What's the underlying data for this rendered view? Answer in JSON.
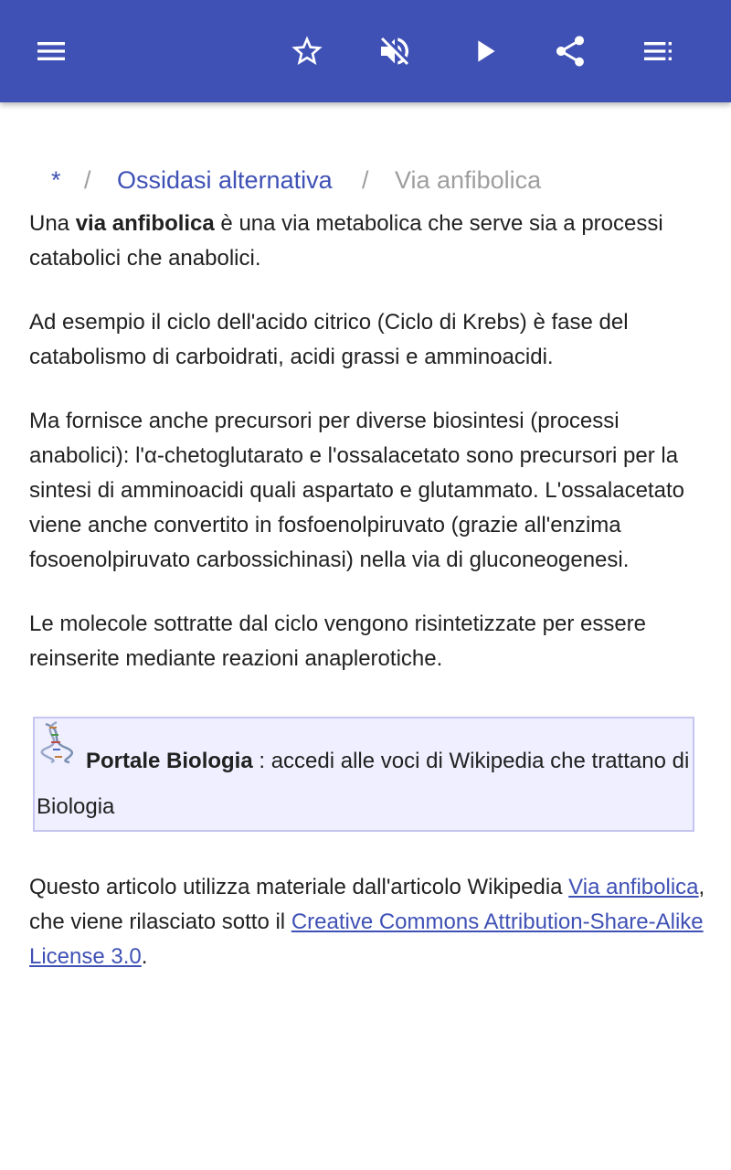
{
  "toolbar": {
    "icons": [
      "menu-icon",
      "star-icon",
      "volume-off-icon",
      "play-icon",
      "share-icon",
      "list-icon"
    ],
    "color": "#3f51b5"
  },
  "breadcrumb": {
    "home": "*",
    "separator": "/",
    "parent": "Ossidasi alternativa",
    "current": "Via anfibolica"
  },
  "article": {
    "p1_pre": "Una ",
    "p1_bold": "via anfibolica",
    "p1_post": " è una via metabolica che serve sia a processi catabolici che anabolici.",
    "p2": "Ad esempio il ciclo dell'acido citrico (Ciclo di Krebs) è fase del catabolismo di carboidrati, acidi grassi e amminoacidi.",
    "p3": "Ma fornisce anche precursori per diverse biosintesi (processi anabolici): l'α-chetoglutarato e l'ossalacetato sono precursori per la sintesi di amminoacidi quali aspartato e glutammato. L'ossalacetato viene anche convertito in fosfoenolpiruvato (grazie all'enzima fosoenolpiruvato carbossichinasi) nella via di gluconeogenesi.",
    "p4": "Le molecole sottratte dal ciclo vengono risintetizzate per essere reinserite mediante reazioni anaplerotiche."
  },
  "portal": {
    "icon": "dna-icon",
    "link": "Portale Biologia",
    "text": " : accedi alle voci di Wikipedia che trattano di Biologia"
  },
  "footer": {
    "pre": "Questo articolo utilizza materiale dall'articolo Wikipedia ",
    "link1": "Via anfibolica",
    "mid": ", che viene rilasciato sotto il ",
    "link2": "Creative Commons Attribution-Share-Alike License 3.0",
    "post": "."
  }
}
